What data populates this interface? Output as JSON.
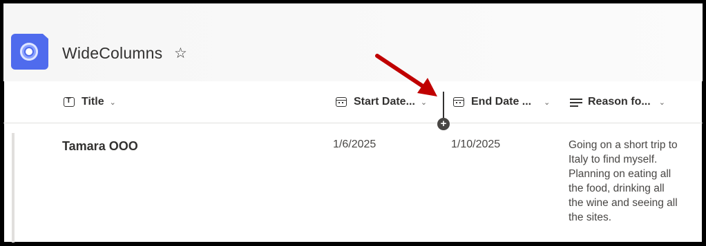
{
  "list": {
    "title": "WideColumns",
    "favorite_icon": "star-icon"
  },
  "columns": [
    {
      "label": "Title",
      "icon": "text-type-icon"
    },
    {
      "label": "Start Date...",
      "icon": "calendar-icon"
    },
    {
      "label": "End Date ...",
      "icon": "calendar-icon"
    },
    {
      "label": "Reason fo...",
      "icon": "multiline-text-icon"
    }
  ],
  "rows": [
    {
      "title": "Tamara OOO",
      "start_date": "1/6/2025",
      "end_date": "1/10/2025",
      "reason": "Going on a short trip to Italy to find myself. Planning on eating all the food, drinking all the wine and seeing all the sites."
    }
  ],
  "add_column_symbol": "+",
  "colors": {
    "accent": "#4f6bed",
    "annotation_arrow": "#c00000"
  }
}
